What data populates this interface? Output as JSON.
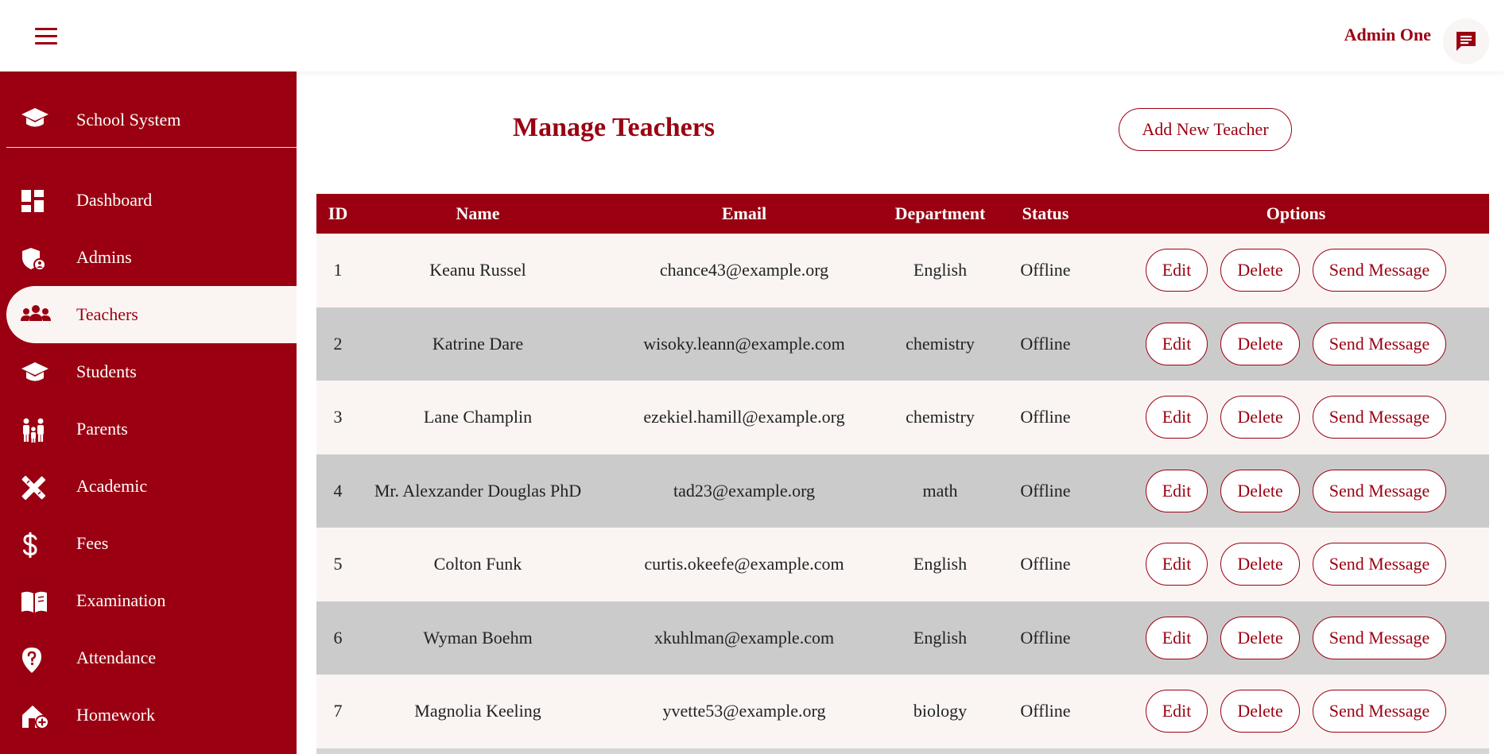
{
  "header": {
    "admin_name": "Admin One",
    "menu_icon": "hamburger-icon",
    "message_icon": "chat-icon"
  },
  "sidebar": {
    "brand": {
      "label": "School System",
      "icon": "graduation-cap-icon"
    },
    "items": [
      {
        "label": "Dashboard",
        "icon": "dashboard-icon",
        "active": false
      },
      {
        "label": "Admins",
        "icon": "admin-shield-icon",
        "active": false
      },
      {
        "label": "Teachers",
        "icon": "users-icon",
        "active": true
      },
      {
        "label": "Students",
        "icon": "graduation-cap-icon",
        "active": false
      },
      {
        "label": "Parents",
        "icon": "family-icon",
        "active": false
      },
      {
        "label": "Academic",
        "icon": "ruler-pencil-icon",
        "active": false
      },
      {
        "label": "Fees",
        "icon": "dollar-icon",
        "active": false
      },
      {
        "label": "Examination",
        "icon": "book-open-icon",
        "active": false
      },
      {
        "label": "Attendance",
        "icon": "location-question-icon",
        "active": false
      },
      {
        "label": "Homework",
        "icon": "house-add-icon",
        "active": false
      }
    ]
  },
  "main": {
    "title": "Manage Teachers",
    "add_button": "Add New Teacher",
    "table": {
      "headers": [
        "ID",
        "Name",
        "Email",
        "Department",
        "Status",
        "Options"
      ],
      "rows": [
        {
          "id": "1",
          "name": "Keanu Russel",
          "email": "chance43@example.org",
          "department": "English",
          "status": "Offline"
        },
        {
          "id": "2",
          "name": "Katrine Dare",
          "email": "wisoky.leann@example.com",
          "department": "chemistry",
          "status": "Offline"
        },
        {
          "id": "3",
          "name": "Lane Champlin",
          "email": "ezekiel.hamill@example.org",
          "department": "chemistry",
          "status": "Offline"
        },
        {
          "id": "4",
          "name": "Mr. Alexzander Douglas PhD",
          "email": "tad23@example.org",
          "department": "math",
          "status": "Offline"
        },
        {
          "id": "5",
          "name": "Colton Funk",
          "email": "curtis.okeefe@example.com",
          "department": "English",
          "status": "Offline"
        },
        {
          "id": "6",
          "name": "Wyman Boehm",
          "email": "xkuhlman@example.com",
          "department": "English",
          "status": "Offline"
        },
        {
          "id": "7",
          "name": "Magnolia Keeling",
          "email": "yvette53@example.org",
          "department": "biology",
          "status": "Offline"
        }
      ],
      "actions": {
        "edit": "Edit",
        "delete": "Delete",
        "message": "Send Message"
      }
    }
  },
  "colors": {
    "accent": "#9a0011",
    "row_light": "#faf5f3",
    "row_dark": "#cbcbcb"
  }
}
